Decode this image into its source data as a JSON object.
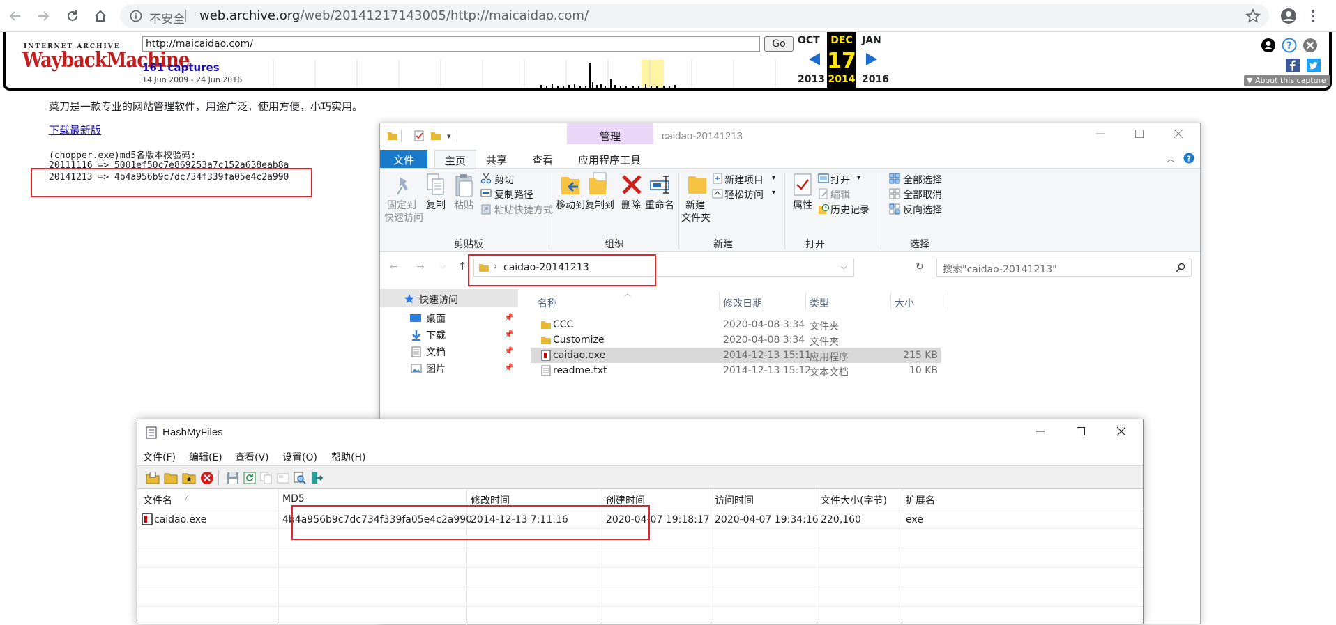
{
  "browser": {
    "insecure_label": "不安全",
    "url_host": "web.archive.org",
    "url_path": "/web/20141217143005/http://maicaidao.com/"
  },
  "wayback": {
    "logo_top": "INTERNET ARCHIVE",
    "logo_main": "WaybackMachine",
    "url_value": "http://maicaidao.com/",
    "go_label": "Go",
    "captures_link": "161 captures",
    "date_range": "14 Jun 2009 - 24 Jun 2016",
    "months": {
      "prev": "OCT",
      "current": "DEC",
      "next": "JAN"
    },
    "day": "17",
    "years": {
      "prev": "2013",
      "current": "2014",
      "next": "2016"
    },
    "about_label": "About this capture"
  },
  "page": {
    "description": "菜刀是一款专业的网站管理软件，用途广泛，使用方便，小巧实用。",
    "download_link": "下载最新版",
    "md5_title": "(chopper.exe)md5各版本校验码:",
    "md5_line1": "20111116 => 5001ef50c7e869253a7c152a638eab8a",
    "md5_line2": "20141213 => 4b4a956b9c7dc734f339fa05e4c2a990"
  },
  "explorer": {
    "title": "caidao-20141213",
    "manage_tab": "管理",
    "tabs": {
      "file": "文件",
      "home": "主页",
      "share": "共享",
      "view": "查看",
      "apptools": "应用程序工具"
    },
    "ribbon": {
      "pin_line1": "固定到",
      "pin_line2": "快速访问",
      "copy": "复制",
      "paste": "粘贴",
      "cut": "剪切",
      "copy_path": "复制路径",
      "paste_shortcut": "粘贴快捷方式",
      "group_clipboard": "剪贴板",
      "move_to": "移动到",
      "copy_to": "复制到",
      "delete": "删除",
      "rename": "重命名",
      "group_organize": "组织",
      "new_folder_line1": "新建",
      "new_folder_line2": "文件夹",
      "new_item": "新建项目",
      "easy_access": "轻松访问",
      "group_new": "新建",
      "properties": "属性",
      "open": "打开",
      "edit": "编辑",
      "history": "历史记录",
      "group_open": "打开",
      "select_all": "全部选择",
      "select_none": "全部取消",
      "invert_selection": "反向选择",
      "group_select": "选择"
    },
    "address_path": "caidao-20141213",
    "search_placeholder": "搜索\"caidao-20141213\"",
    "nav": {
      "quick_access": "快速访问",
      "desktop": "桌面",
      "downloads": "下载",
      "documents": "文档",
      "pictures": "图片"
    },
    "columns": {
      "name": "名称",
      "modified": "修改日期",
      "type": "类型",
      "size": "大小"
    },
    "rows": [
      {
        "name": "CCC",
        "modified": "2020-04-08 3:34",
        "type": "文件夹",
        "size": "",
        "icon": "folder-icon"
      },
      {
        "name": "Customize",
        "modified": "2020-04-08 3:34",
        "type": "文件夹",
        "size": "",
        "icon": "folder-icon"
      },
      {
        "name": "caidao.exe",
        "modified": "2014-12-13 15:11",
        "type": "应用程序",
        "size": "215 KB",
        "icon": "exe-icon"
      },
      {
        "name": "readme.txt",
        "modified": "2014-12-13 15:12",
        "type": "文本文档",
        "size": "10 KB",
        "icon": "text-file-icon"
      }
    ]
  },
  "hashmyfiles": {
    "title": "HashMyFiles",
    "menu": {
      "file": "文件(F)",
      "edit": "编辑(E)",
      "view": "查看(V)",
      "settings": "设置(O)",
      "help": "帮助(H)"
    },
    "columns": {
      "filename": "文件名",
      "md5": "MD5",
      "modified": "修改时间",
      "created": "创建时间",
      "accessed": "访问时间",
      "size": "文件大小(字节)",
      "ext": "扩展名"
    },
    "row": {
      "filename": "caidao.exe",
      "md5": "4b4a956b9c7dc734f339fa05e4c2a990",
      "modified": "2014-12-13 7:11:16",
      "created": "2020-04-07 19:18:17",
      "accessed": "2020-04-07 19:34:16",
      "size": "220,160",
      "ext": "exe"
    }
  },
  "colors": {
    "highlight_red": "#e0242b",
    "ribbon_blue": "#1979ca",
    "manage_purple": "#ead6f7"
  }
}
